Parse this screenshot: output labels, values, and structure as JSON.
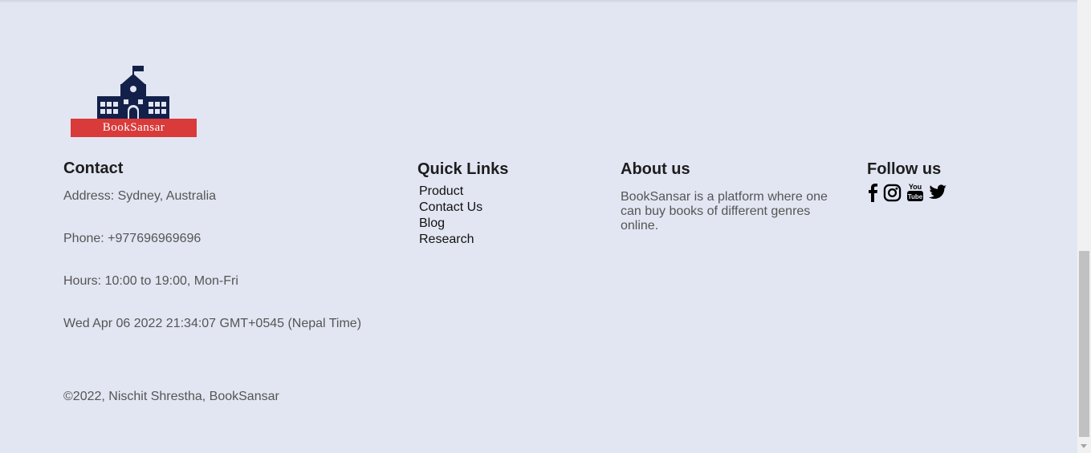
{
  "brand": {
    "name": "BookSansar"
  },
  "contact": {
    "title": "Contact",
    "address": "Address: Sydney, Australia",
    "phone": "Phone: +977696969696",
    "hours": "Hours: 10:00 to 19:00, Mon-Fri",
    "datetime": "Wed Apr 06 2022 21:34:07 GMT+0545 (Nepal Time)"
  },
  "quick_links": {
    "title": "Quick Links",
    "items": [
      "Product",
      "Contact Us",
      "Blog",
      "Research"
    ]
  },
  "about": {
    "title": "About us",
    "text": "BookSansar is a platform where one can buy books of different genres online."
  },
  "follow": {
    "title": "Follow us",
    "icons": [
      "facebook-icon",
      "instagram-icon",
      "youtube-icon",
      "twitter-icon"
    ]
  },
  "footer": {
    "copyright": "©2022, Nischit Shrestha, BookSansar"
  },
  "colors": {
    "background": "#e2e6f2",
    "logo_navy": "#13214a",
    "logo_red": "#d93a3a"
  }
}
